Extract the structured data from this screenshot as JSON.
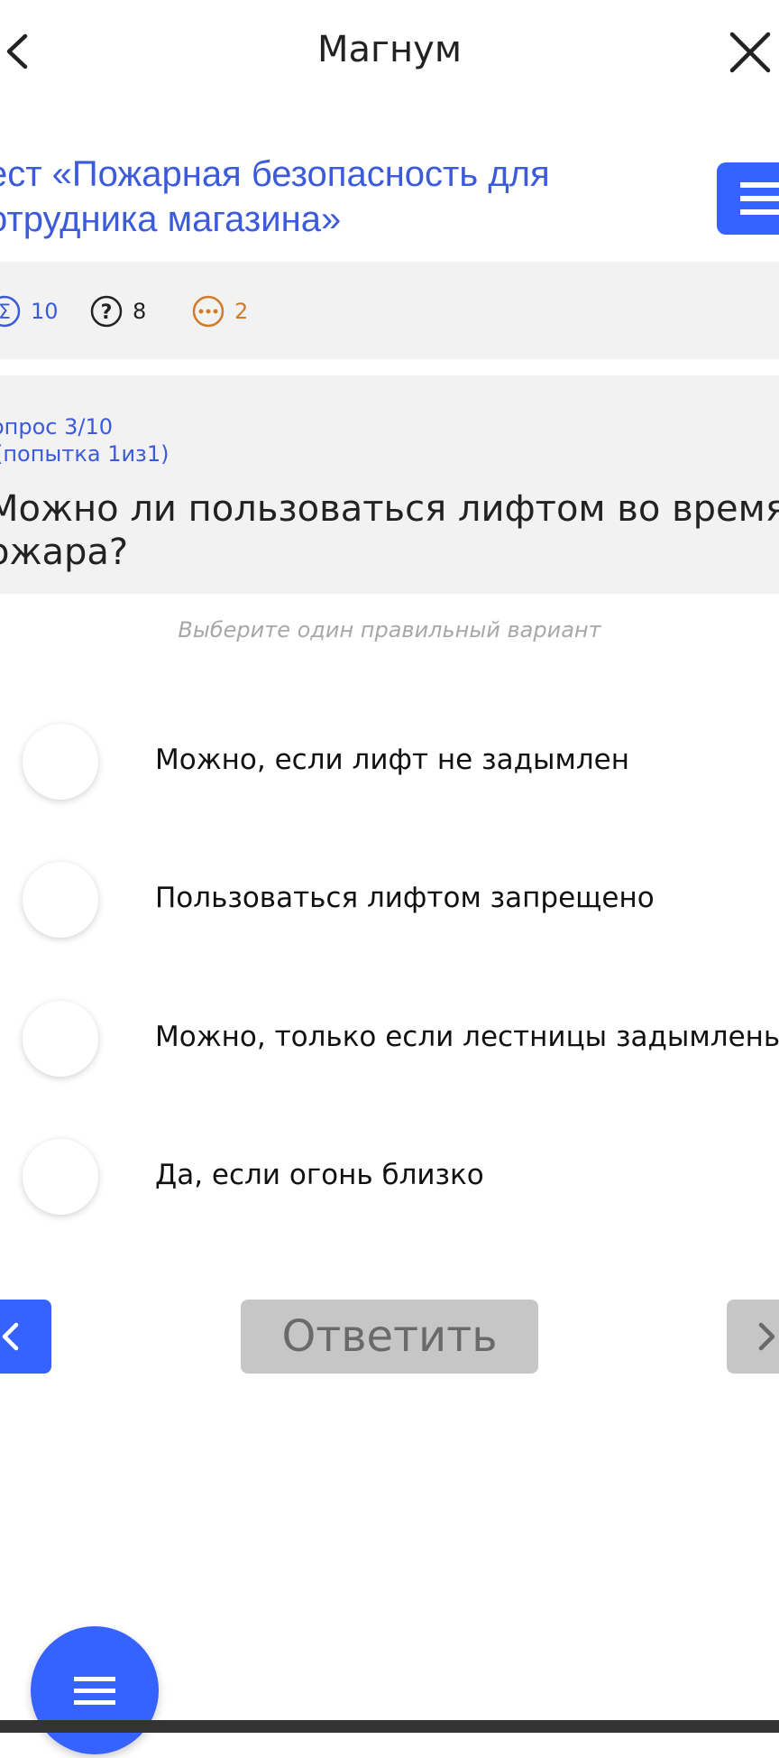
{
  "header": {
    "title": "Магнум",
    "back_icon": "chevron-left-icon",
    "close_icon": "close-icon"
  },
  "test": {
    "title_line1": "ест «Пожарная безопасность для",
    "title_line2": "отрудника магазина»",
    "menu_icon": "menu-icon"
  },
  "stats": {
    "total": "10",
    "questions": "8",
    "remaining": "2"
  },
  "question": {
    "number": "опрос 3/10",
    "attempt": "(попытка 1из1)",
    "text_line1": "Можно ли пользоваться лифтом во время",
    "text_line2": "ожара?",
    "hint": "Выберите один правильный вариант"
  },
  "options": [
    {
      "label": "Можно, если лифт не задымлен"
    },
    {
      "label": "Пользоваться лифтом запрещено"
    },
    {
      "label": "Можно, только если лестницы задымлены"
    },
    {
      "label": "Да, если огонь близко"
    }
  ],
  "nav": {
    "answer_label": "Ответить"
  },
  "colors": {
    "accent": "#3663ff",
    "title_blue": "#3b5bdb",
    "orange": "#d07a2a",
    "disabled": "#c6c6c6"
  }
}
